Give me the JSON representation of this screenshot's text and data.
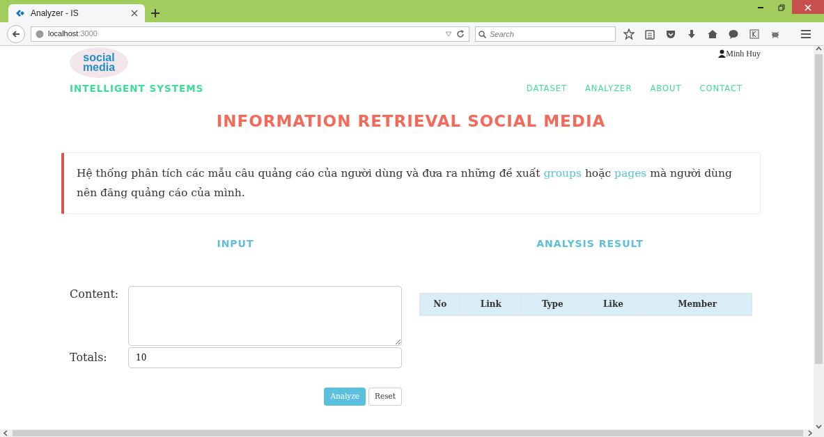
{
  "browser": {
    "tab_title": "Analyzer - IS",
    "url_host": "localhost",
    "url_port": ":3000",
    "search_placeholder": "Search"
  },
  "header": {
    "logo": [
      "social",
      "media"
    ],
    "brand": "INTELLIGENT SYSTEMS",
    "user": "Minh Huy",
    "nav": [
      {
        "label": "DATASET"
      },
      {
        "label": "ANALYZER"
      },
      {
        "label": "ABOUT"
      },
      {
        "label": "CONTACT"
      }
    ]
  },
  "title": "INFORMATION RETRIEVAL SOCIAL MEDIA",
  "notice": [
    {
      "kind": "text",
      "text": "Hệ thống phân tích các mẫu câu quảng cáo của người dùng và đưa ra những đề xuất"
    },
    {
      "kind": "link",
      "text": "groups"
    },
    {
      "kind": "text",
      "text": "hoặc"
    },
    {
      "kind": "link",
      "text": "pages"
    },
    {
      "kind": "text",
      "text": "mà người dùng nên đăng quảng cáo của mình."
    }
  ],
  "input": {
    "heading": "INPUT",
    "content_label": "Content:",
    "totals_label": "Totals:",
    "totals_value": "10",
    "buttons": [
      {
        "label": "Analyze",
        "kind": "primary"
      },
      {
        "label": "Reset",
        "kind": "default"
      }
    ]
  },
  "result": {
    "heading": "ANALYSIS RESULT",
    "columns": [
      "No",
      "Link",
      "Type",
      "Like",
      "Member"
    ]
  }
}
